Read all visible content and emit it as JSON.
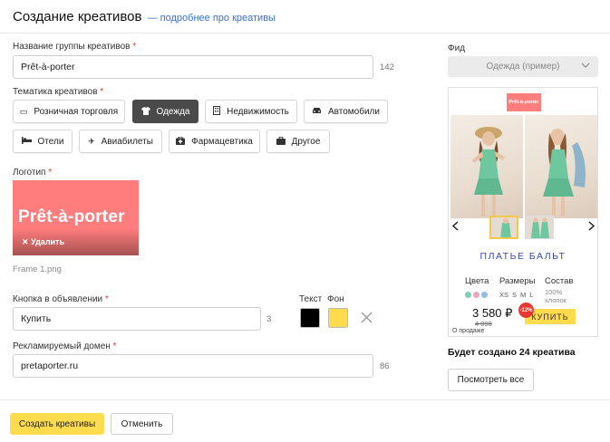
{
  "header": {
    "title": "Создание креативов",
    "link": "— подробнее про креативы"
  },
  "group_name": {
    "label": "Название группы креативов",
    "value": "Prêt-à-porter",
    "counter": "142"
  },
  "topic": {
    "label": "Тематика креативов",
    "chips": [
      {
        "label": "Розничная торговля",
        "icon": "shop-icon"
      },
      {
        "label": "Одежда",
        "icon": "tshirt-icon",
        "active": true
      },
      {
        "label": "Недвижимость",
        "icon": "building-icon"
      },
      {
        "label": "Автомобили",
        "icon": "car-icon"
      },
      {
        "label": "Отели",
        "icon": "bed-icon"
      },
      {
        "label": "Авиабилеты",
        "icon": "plane-icon"
      },
      {
        "label": "Фармацевтика",
        "icon": "pharmacy-icon"
      },
      {
        "label": "Другое",
        "icon": "briefcase-icon"
      }
    ]
  },
  "logo": {
    "label": "Логотип",
    "text": "Prêt-à-porter",
    "delete_label": "Удалить",
    "filename": "Frame 1.png",
    "color": "#ff7d7d"
  },
  "ad_button": {
    "label": "Кнопка в объявлении",
    "value": "Купить",
    "counter": "3",
    "text_color_label": "Текст",
    "bg_color_label": "Фон",
    "text_color": "#000000",
    "bg_color": "#ffdb4d"
  },
  "domain": {
    "label": "Рекламируемый домен",
    "value": "pretaporter.ru",
    "counter": "86"
  },
  "feed": {
    "label": "Фид",
    "selected": "Одежда (пример)"
  },
  "preview": {
    "logo_text": "Prêt-à-porter",
    "product_name": "ПЛАТЬЕ БАЛЬТ",
    "colors_label": "Цвета",
    "sizes_label": "Размеры",
    "composition_label": "Состав",
    "composition_value": "100% хлопок",
    "sizes": [
      "XS",
      "S",
      "M",
      "L"
    ],
    "dot_colors": [
      "#7fcfb8",
      "#e8a8c0",
      "#8fc0e8"
    ],
    "price": "3 580 ₽",
    "old_price": "4 090",
    "discount": "-12%",
    "buy_label": "КУПИТЬ",
    "on_sale": "О продаже"
  },
  "summary": {
    "text": "Будет создано 24 креатива",
    "view_all": "Посмотреть все"
  },
  "footer": {
    "create_label": "Создать креативы",
    "cancel_label": "Отменить"
  }
}
